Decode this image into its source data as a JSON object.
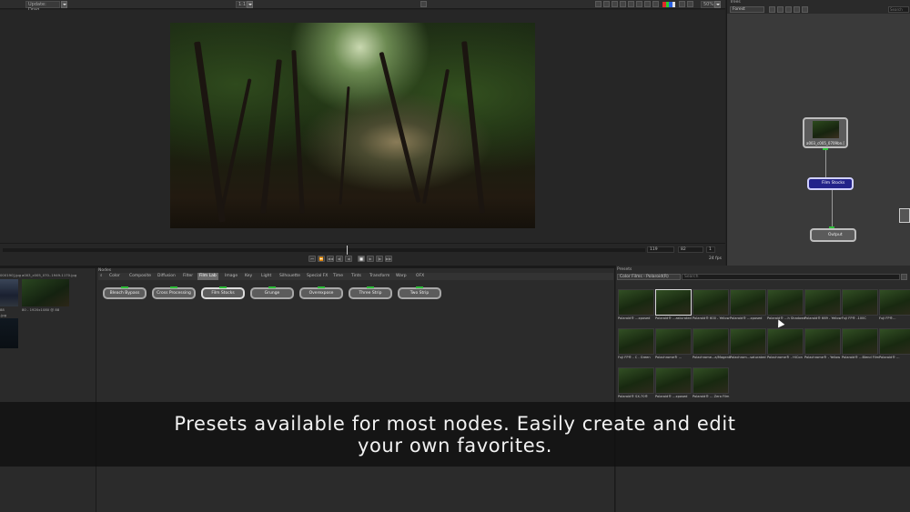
{
  "toolbar": {
    "update_mode": "Update: Drag",
    "zoom_ratio": "1:1",
    "zoom_percent": "50%",
    "swatch_colors": [
      "#e02a2a",
      "#2ad02a",
      "#2a5fe0",
      "#e0e0e0"
    ]
  },
  "timeline": {
    "current_frame": "119",
    "end_frame": "82",
    "step": "1",
    "fps": "24 fps",
    "progress": 0.535,
    "transport": [
      "⏮",
      "⏪",
      "◀◀",
      "◀|",
      "◀",
      "■",
      "▶",
      "|▶",
      "▶▶"
    ]
  },
  "tree": {
    "title": "Trees",
    "select": "Forest",
    "search_placeholder": "Search",
    "nodes": {
      "read": "a003_c005_0709bn.[",
      "film": "Film Stocks",
      "output": "Output"
    }
  },
  "bin": {
    "items": [
      {
        "label_top": "000190].jpg",
        "label_bottom": "88"
      },
      {
        "label_top": "a003_c005_070..1949-1170.jpg",
        "label_bottom": "80 - 1920x1080 @ 88"
      },
      {
        "label_top": "",
        "label_bottom": ".jpg"
      }
    ]
  },
  "nodes": {
    "title": "Nodes",
    "tabs": [
      "Color",
      "Composite",
      "Diffusion",
      "Filter",
      "Film Lab",
      "Image",
      "Key",
      "Light",
      "Silhouette",
      "Special FX",
      "Time",
      "Tints",
      "Transform",
      "Warp",
      "OFX"
    ],
    "active_tab": "Film Lab",
    "buttons": [
      "Bleach Bypass",
      "Cross Processing",
      "Film Stocks",
      "Grunge",
      "Overexpose",
      "Three Strip",
      "Two Strip"
    ],
    "selected_button": "Film Stocks"
  },
  "presets": {
    "title": "Presets",
    "category": "Color Films - Polaroid(R)",
    "search_placeholder": "Search",
    "selected_index": 1,
    "items": [
      "Polaroid® ...xposed",
      "Polaroid® ...asturated",
      "Polaroid® 600 - Yellow",
      "Polaroid® ...xposed",
      "Polaroid® ...h Shadows",
      "Polaroid® 669 - Yellow",
      "Fuji FP® -100C",
      "Fuji FP®...",
      "Fuji FP® - C - Green",
      "Polachrome® ...",
      "Polachrome...a/Magenta",
      "Polachrom...saturated",
      "Polachrome® - HiCon",
      "Polachrome® - Yellow",
      "Polaroid® ...Blend Film",
      "Polaroid® ...",
      "Polaroid® SX-70®",
      "Polaroid® ...xposed",
      "Polaroid® ... Zero Film"
    ]
  },
  "caption": {
    "line1": "Presets available for most nodes. Easily create and edit",
    "line2": "your own favorites."
  }
}
